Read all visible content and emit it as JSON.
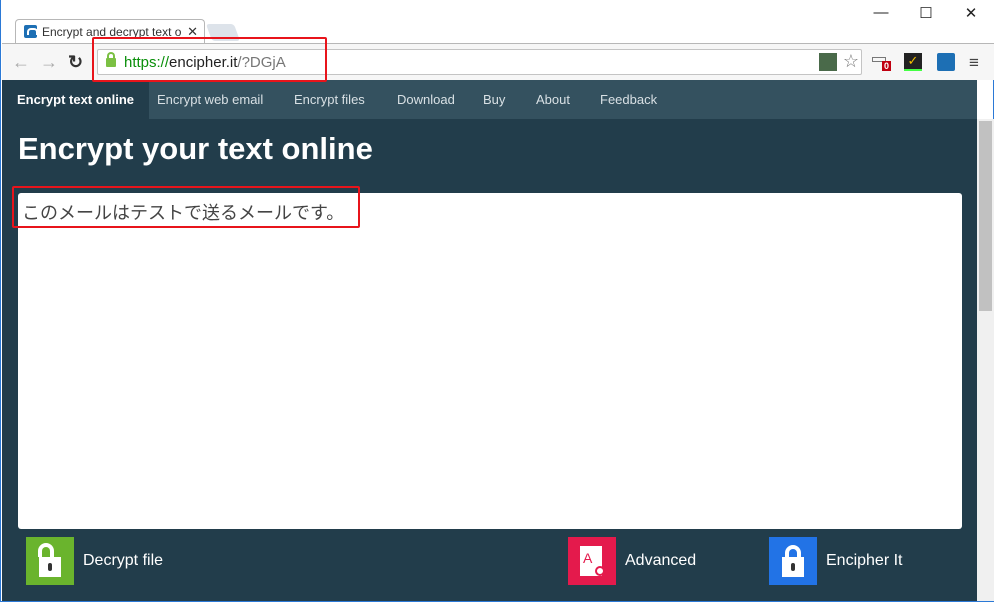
{
  "browser": {
    "tab_title": "Encrypt and decrypt text o",
    "url_scheme": "https://",
    "url_host": "encipher.it",
    "url_path": "/?DGjA",
    "badge_count": "0"
  },
  "nav": {
    "items": [
      "Encrypt text online",
      "Encrypt web email",
      "Encrypt files",
      "Download",
      "Buy",
      "About",
      "Feedback"
    ]
  },
  "main": {
    "title": "Encrypt your text online",
    "text": "このメールはテストで送るメールです。",
    "actions": {
      "decrypt": "Decrypt file",
      "advanced": "Advanced",
      "encipher": "Encipher It"
    }
  },
  "colors": {
    "decrypt": "#6ab42d",
    "advanced": "#e41a4c",
    "encipher": "#2273e6",
    "page_bg": "#223d4b",
    "nav_bg": "#34515f",
    "annotation": "#e8141b"
  }
}
